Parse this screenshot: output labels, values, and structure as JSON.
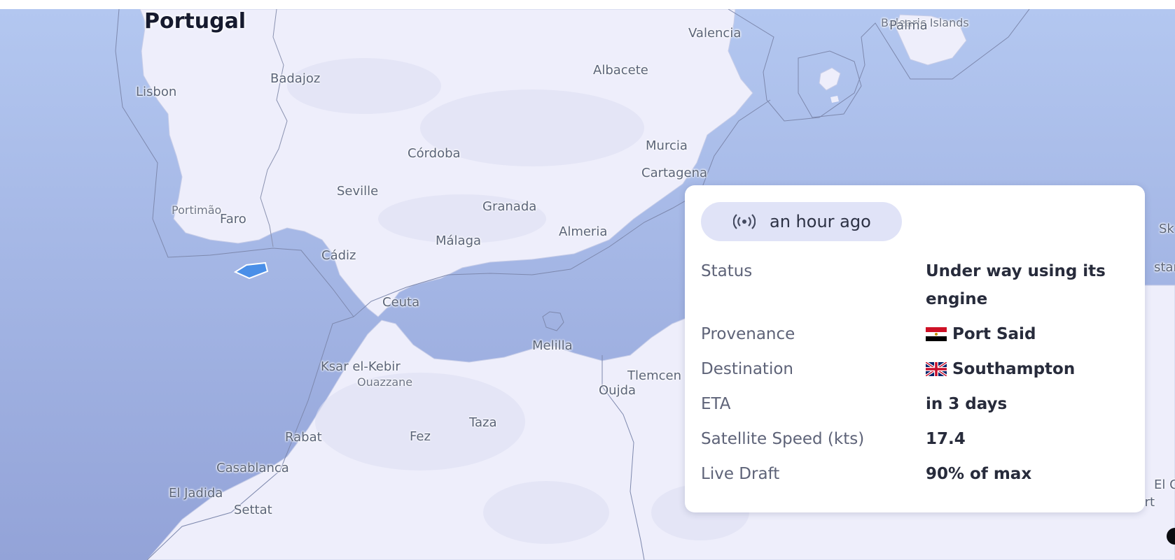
{
  "map": {
    "country": "Portugal",
    "cities": {
      "valencia": "Valencia",
      "palma": "Palma",
      "balearic": "Balearic Islands",
      "badajoz": "Badajoz",
      "albacete": "Albacete",
      "lisbon": "Lisbon",
      "cordoba": "Córdoba",
      "murcia": "Murcia",
      "cartagena": "Cartagena",
      "seville": "Seville",
      "granada": "Granada",
      "portimao": "Portimão",
      "faro": "Faro",
      "almeria": "Almeria",
      "malaga": "Málaga",
      "cadiz": "Cádiz",
      "ceuta": "Ceuta",
      "melilla": "Melilla",
      "ksar": "Ksar el-Kebir",
      "ouazzane": "Ouazzane",
      "tlemcen": "Tlemcen",
      "oujda": "Oujda",
      "taza": "Taza",
      "rabat": "Rabat",
      "fez": "Fez",
      "casablanca": "Casablanca",
      "eljadida": "El Jadida",
      "settat": "Settat",
      "touggourt": "Touggourt",
      "edge_sk": "Sk",
      "edge_stan": "stan",
      "edge_elo": "El O"
    }
  },
  "popup": {
    "last_seen": "an hour ago",
    "rows": [
      {
        "key": "Status",
        "value": "Under way using its engine"
      },
      {
        "key": "Provenance",
        "value": "Port Said",
        "flag": "egypt-flag"
      },
      {
        "key": "Destination",
        "value": "Southampton",
        "flag": "uk-flag"
      },
      {
        "key": "ETA",
        "value": "in 3 days"
      },
      {
        "key": "Satellite Speed (kts)",
        "value": "17.4"
      },
      {
        "key": "Live Draft",
        "value": "90% of max"
      }
    ]
  },
  "colors": {
    "sea_top": "#b3c7f0",
    "sea_bottom": "#95a6d9",
    "land": "#eeeefb",
    "vessel": "#4a8fe8"
  }
}
